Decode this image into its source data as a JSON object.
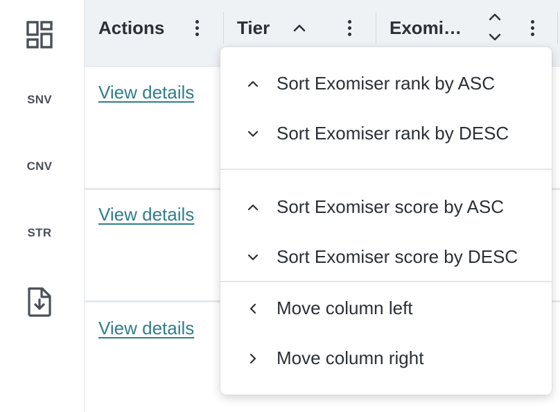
{
  "rail": {
    "items": [
      {
        "label": "",
        "icon": "dashboard-icon"
      },
      {
        "label": "SNV"
      },
      {
        "label": "CNV"
      },
      {
        "label": "STR"
      },
      {
        "label": "",
        "icon": "file-download-icon"
      }
    ]
  },
  "table": {
    "columns": [
      {
        "label": "Actions"
      },
      {
        "label": "Tier"
      },
      {
        "label": "Exomi…"
      }
    ],
    "rows": [
      {
        "action": "View details"
      },
      {
        "action": "View details"
      },
      {
        "action": "View details"
      }
    ]
  },
  "menu": {
    "groups": [
      [
        {
          "label": "Sort Exomiser rank by ASC",
          "icon": "chevron-up-icon"
        },
        {
          "label": "Sort Exomiser rank by DESC",
          "icon": "chevron-down-icon"
        }
      ],
      [
        {
          "label": "Sort Exomiser score by ASC",
          "icon": "chevron-up-icon"
        },
        {
          "label": "Sort Exomiser score by DESC",
          "icon": "chevron-down-icon"
        }
      ],
      [
        {
          "label": "Move column left",
          "icon": "chevron-left-icon"
        },
        {
          "label": "Move column right",
          "icon": "chevron-right-icon"
        }
      ]
    ]
  },
  "colors": {
    "accent_link": "#2f7d8c",
    "header_bg": "#eef2f5",
    "text": "#2b2f36"
  }
}
